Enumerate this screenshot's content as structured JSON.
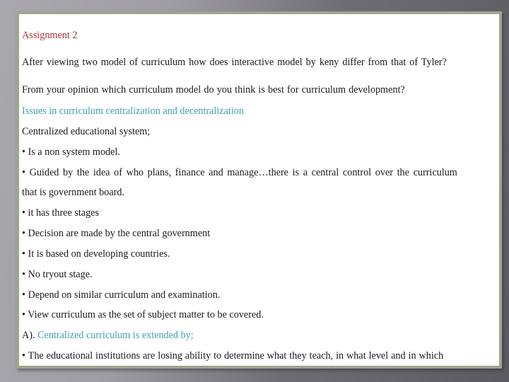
{
  "slide": {
    "title": "Assignment 2",
    "question_1": "After viewing two model of curriculum how does interactive model by keny differ from that of Tyler?",
    "question_2": "From your opinion which curriculum model do you think is best for curriculum development?",
    "section_heading": "Issues in curriculum centralization and decentralization",
    "subheading": "Centralized educational system;",
    "bullets": [
      "• Is a non system model.",
      "• Guided by the idea of who plans, finance and manage…there is a central control over the curriculum",
      "that is government board.",
      "• it has three stages",
      "• Decision are made by the central government",
      "• It is based on developing countries.",
      "• No tryout stage.",
      "• Depend on similar curriculum and examination.",
      "• View curriculum as the set of subject matter to be covered."
    ],
    "point_a_prefix": "A).",
    "point_a_text": "Centralized curriculum is extended by;",
    "last_bullet": "• The educational institutions are losing ability to determine what they teach, in what level and in which"
  },
  "colors": {
    "title": "#b0333a",
    "heading": "#3aa3b3",
    "border": "#9ca68c",
    "text": "#1a1a1a"
  }
}
